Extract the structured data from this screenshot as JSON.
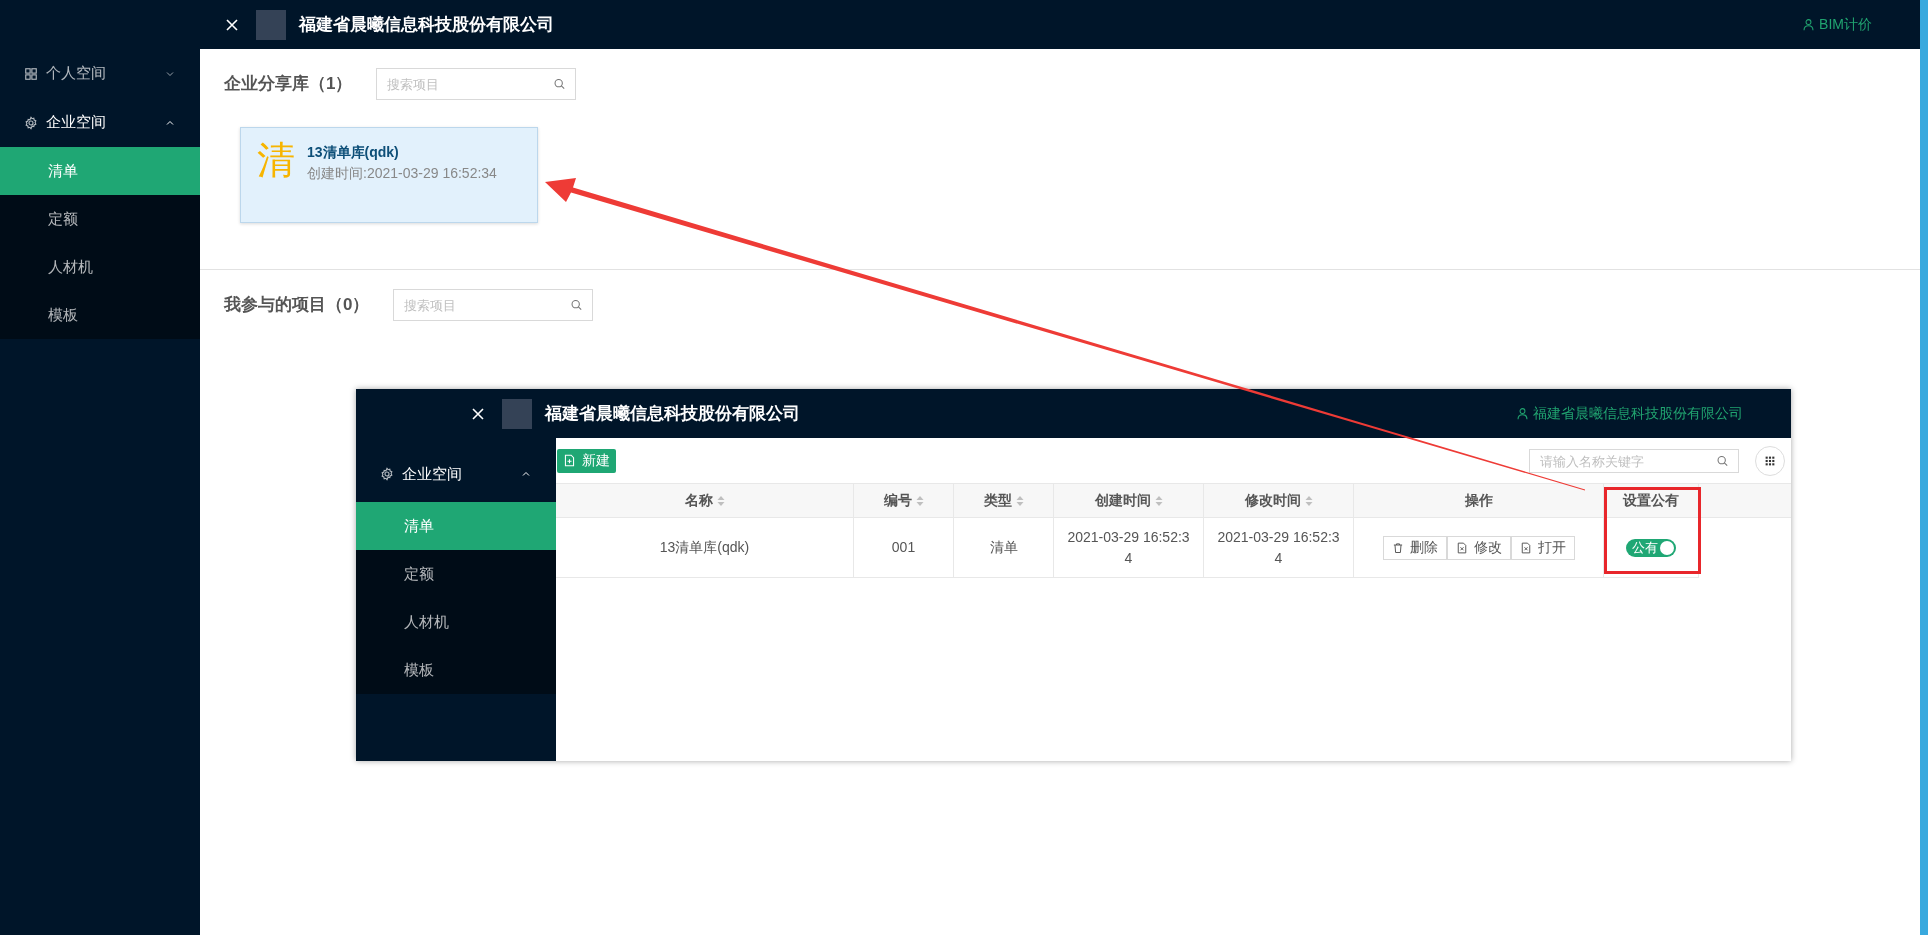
{
  "header": {
    "title": "福建省晨曦信息科技股份有限公司",
    "user": "BIM计价"
  },
  "sidebar": {
    "groups": [
      {
        "label": "个人空间",
        "expanded": false
      },
      {
        "label": "企业空间",
        "expanded": true,
        "children": [
          {
            "label": "清单",
            "selected": true
          },
          {
            "label": "定额",
            "selected": false
          },
          {
            "label": "人材机",
            "selected": false
          },
          {
            "label": "模板",
            "selected": false
          }
        ]
      }
    ]
  },
  "sections": [
    {
      "title": "企业分享库（1）",
      "search": {
        "placeholder": "搜索项目"
      },
      "cards": [
        {
          "glyph": "清",
          "name": "13清单库(qdk)",
          "created": "创建时间:2021-03-29 16:52:34"
        }
      ]
    },
    {
      "title": "我参与的项目（0）",
      "search": {
        "placeholder": "搜索项目"
      }
    }
  ],
  "inset": {
    "header": {
      "title": "福建省晨曦信息科技股份有限公司",
      "user": "福建省晨曦信息科技股份有限公司"
    },
    "sidebar": {
      "groups": [
        {
          "label": "企业空间",
          "expanded": true,
          "children": [
            {
              "label": "清单",
              "selected": true
            },
            {
              "label": "定额",
              "selected": false
            },
            {
              "label": "人材机",
              "selected": false
            },
            {
              "label": "模板",
              "selected": false
            }
          ]
        }
      ]
    },
    "new_button": "新建",
    "search": {
      "placeholder": "请输入名称关键字"
    },
    "table": {
      "columns": [
        {
          "label": "名称",
          "sortable": true
        },
        {
          "label": "编号",
          "sortable": true
        },
        {
          "label": "类型",
          "sortable": true
        },
        {
          "label": "创建时间",
          "sortable": true
        },
        {
          "label": "修改时间",
          "sortable": true
        },
        {
          "label": "操作",
          "sortable": false
        },
        {
          "label": "设置公有",
          "sortable": false
        }
      ],
      "rows": [
        {
          "name": "13清单库(qdk)",
          "code": "001",
          "type": "清单",
          "created": "2021-03-29 16:52:34",
          "modified": "2021-03-29 16:52:34",
          "actions": [
            "删除",
            "修改",
            "打开"
          ],
          "public": {
            "label": "公有",
            "on": true
          }
        }
      ]
    }
  }
}
